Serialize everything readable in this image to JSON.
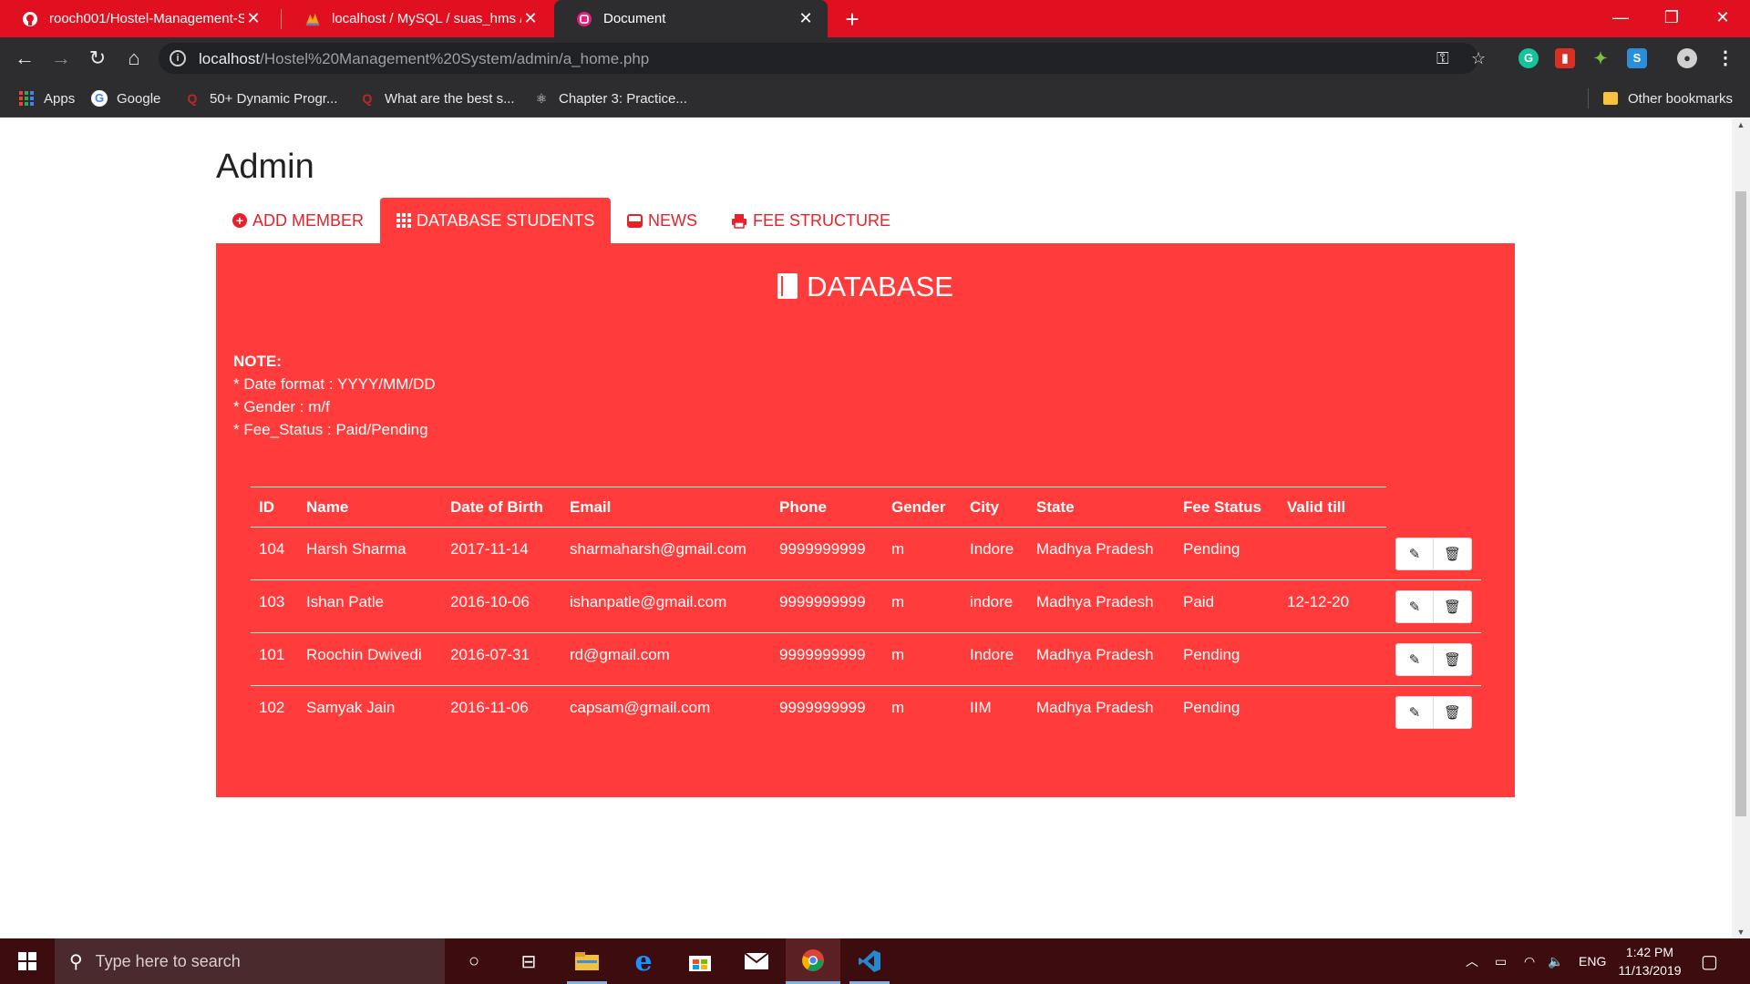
{
  "browser": {
    "tabs": [
      {
        "title": "rooch001/Hostel-Management-S",
        "favicon": "github-icon"
      },
      {
        "title": "localhost / MySQL / suas_hms / f",
        "favicon": "phpmyadmin-icon"
      },
      {
        "title": "Document",
        "favicon": "document-icon"
      }
    ],
    "url_host": "localhost",
    "url_path": "/Hostel%20Management%20System/admin/a_home.php",
    "bookmarks": [
      {
        "label": "Apps",
        "icon": "apps-icon"
      },
      {
        "label": "Google",
        "icon": "google-icon"
      },
      {
        "label": "50+ Dynamic Progr...",
        "icon": "quora-icon"
      },
      {
        "label": "What are the best s...",
        "icon": "quora-icon"
      },
      {
        "label": "Chapter 3: Practice...",
        "icon": "atom-icon"
      }
    ],
    "other_bookmarks": "Other bookmarks"
  },
  "page": {
    "title": "Admin",
    "tabs": [
      {
        "label": "ADD MEMBER",
        "icon": "plus-circle-icon",
        "active": false
      },
      {
        "label": "DATABASE STUDENTS",
        "icon": "grid-icon",
        "active": true
      },
      {
        "label": "NEWS",
        "icon": "inbox-icon",
        "active": false
      },
      {
        "label": "FEE STRUCTURE",
        "icon": "print-icon",
        "active": false
      }
    ],
    "panel_heading": "DATABASE",
    "note": {
      "title": "NOTE:",
      "lines": [
        "* Date format : YYYY/MM/DD",
        "* Gender : m/f",
        "* Fee_Status : Paid/Pending"
      ]
    },
    "table": {
      "columns": [
        "ID",
        "Name",
        "Date of Birth",
        "Email",
        "Phone",
        "Gender",
        "City",
        "State",
        "Fee Status",
        "Valid till"
      ],
      "rows": [
        [
          "104",
          "Harsh Sharma",
          "2017-11-14",
          "sharmaharsh@gmail.com",
          "9999999999",
          "m",
          "Indore",
          "Madhya Pradesh",
          "Pending",
          ""
        ],
        [
          "103",
          "Ishan Patle",
          "2016-10-06",
          "ishanpatle@gmail.com",
          "9999999999",
          "m",
          "indore",
          "Madhya Pradesh",
          "Paid",
          "12-12-20"
        ],
        [
          "101",
          "Roochin Dwivedi",
          "2016-07-31",
          "rd@gmail.com",
          "9999999999",
          "m",
          "Indore",
          "Madhya Pradesh",
          "Pending",
          ""
        ],
        [
          "102",
          "Samyak Jain",
          "2016-11-06",
          "capsam@gmail.com",
          "9999999999",
          "m",
          "IIM",
          "Madhya Pradesh",
          "Pending",
          ""
        ]
      ]
    },
    "colors": {
      "accent": "#ff3b3b",
      "tab_text": "#e8202a",
      "chrome": "#e01020"
    }
  },
  "taskbar": {
    "search_placeholder": "Type here to search",
    "language": "ENG",
    "time": "1:42 PM",
    "date": "11/13/2019"
  }
}
